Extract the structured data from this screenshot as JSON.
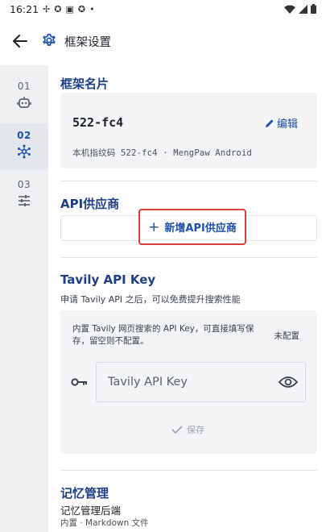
{
  "status_bar": {
    "time": "16:21",
    "left_icons": [
      "notification-fan-icon",
      "app-icon",
      "app-icon-2",
      "app-icon-3",
      "dot-icon"
    ],
    "right_icons": [
      "wifi-icon",
      "signal-icon",
      "battery-icon"
    ]
  },
  "app_bar": {
    "title": "框架设置"
  },
  "sidebar": {
    "steps": [
      {
        "number": "01",
        "icon": "robot-icon",
        "active": false
      },
      {
        "number": "02",
        "icon": "network-icon",
        "active": true
      },
      {
        "number": "03",
        "icon": "sliders-icon",
        "active": false
      }
    ]
  },
  "framework_name": {
    "title": "框架名片",
    "name": "522-fc4",
    "edit_label": "编辑",
    "fingerprint": "本机指纹码 522-fc4 · MengPaw Android"
  },
  "api_providers": {
    "title": "API供应商",
    "add_label": "新增API供应商"
  },
  "tavily": {
    "title": "Tavily API Key",
    "description": "申请 Tavily API 之后，可以免费提升搜索性能",
    "info": "内置 Tavily 网页搜索的 API Key，可直接填写保存，留空则不配置。",
    "status": "未配置",
    "input_placeholder": "Tavily API Key",
    "input_value": "",
    "save_label": "保存"
  },
  "memory": {
    "title": "记忆管理",
    "subtitle": "记忆管理后端",
    "detail": "内置 · Markdown 文件"
  },
  "colors": {
    "accent": "#1c4fa8",
    "section_title": "#1c3f86",
    "highlight_border": "#e03c3c",
    "card_bg": "#f2f4f6",
    "sidebar_bg": "#eef0f2"
  }
}
